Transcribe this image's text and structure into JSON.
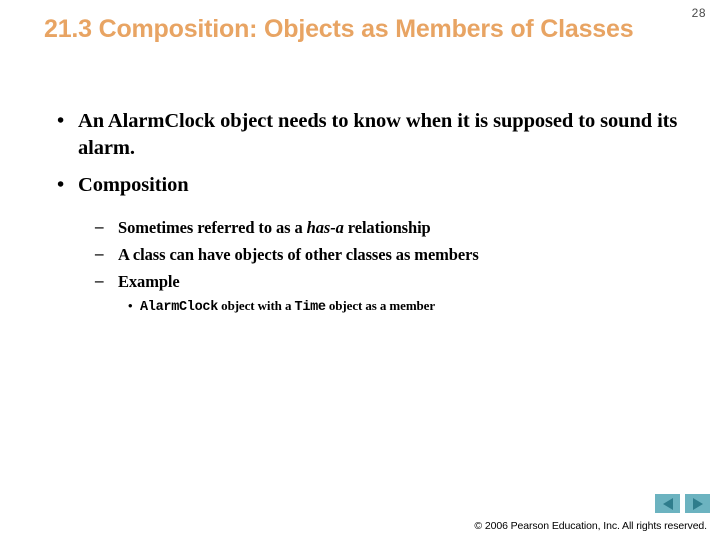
{
  "slide": {
    "page_number": "28",
    "title": "21.3 Composition: Objects as Members of Classes",
    "title_color": "#e8a463",
    "background_color": "#ffffff"
  },
  "bullets": {
    "level1": [
      {
        "marker": "•",
        "text": "An AlarmClock object needs to know when it is supposed to sound its alarm."
      },
      {
        "marker": "•",
        "text": "Composition"
      }
    ],
    "level2": [
      {
        "marker": "–",
        "prefix": "Sometimes referred to as a ",
        "emphasis": "has-a",
        "suffix": " relationship"
      },
      {
        "marker": "–",
        "text": "A class can have objects of other classes as members"
      },
      {
        "marker": "–",
        "text": "Example"
      }
    ],
    "level3": [
      {
        "marker": "•",
        "code1": "AlarmClock",
        "mid": " object with a ",
        "code2": "Time",
        "tail": " object as a member"
      }
    ]
  },
  "footer": {
    "copyright": "© 2006 Pearson Education, Inc.  All rights reserved.",
    "nav": {
      "prev_label": "previous-slide",
      "next_label": "next-slide",
      "button_color": "#6cb3c0",
      "arrow_color": "#2f7d8c"
    }
  }
}
